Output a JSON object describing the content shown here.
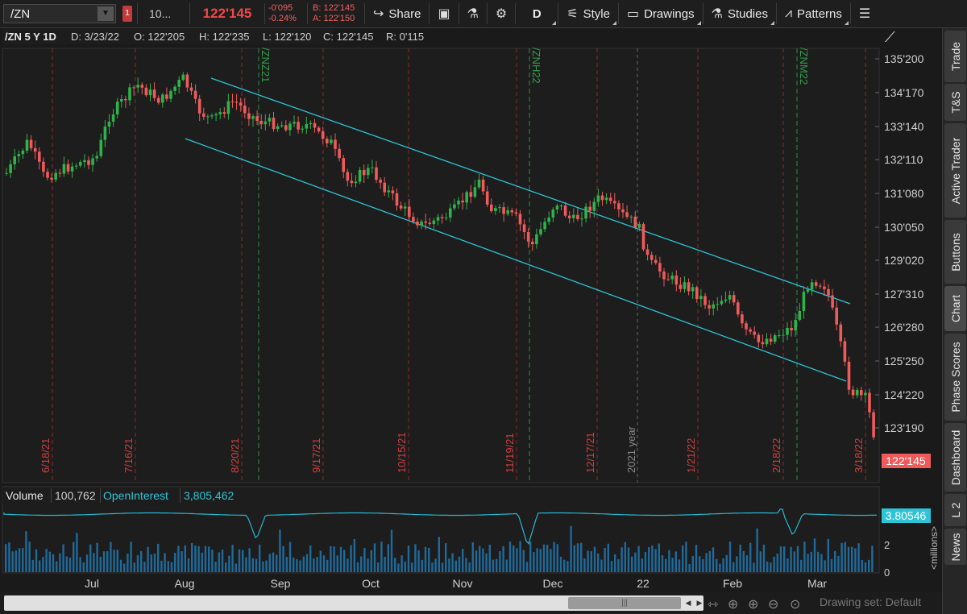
{
  "toolbar": {
    "symbol": "/ZN",
    "link_badge": "1",
    "quantity": "10...",
    "last_price": "122'145",
    "net_change": "-0'095",
    "pct_change": "-0.24%",
    "bid": "B: 122'145",
    "ask": "A: 122'150",
    "share_label": "Share",
    "interval": "D",
    "style_label": "Style",
    "drawings_label": "Drawings",
    "studies_label": "Studies",
    "patterns_label": "Patterns"
  },
  "chart_header": {
    "title": "/ZN 5 Y 1D",
    "date": "D: 3/23/22",
    "open": "O: 122'205",
    "high": "H: 122'235",
    "low": "L: 122'120",
    "close": "C: 122'145",
    "range": "R: 0'115"
  },
  "price_axis": [
    "135'200",
    "134'170",
    "133'140",
    "132'110",
    "131'080",
    "130'050",
    "129'020",
    "127'310",
    "126'280",
    "125'250",
    "124'220",
    "123'190"
  ],
  "current_price_label": "122'145",
  "vertical_markers": {
    "dates": [
      "6/18/21",
      "7/16/21",
      "8/20/21",
      "9/17/21",
      "10/15/21",
      "11/19/21",
      "12/17/21",
      "1/21/22",
      "2/18/22",
      "3/18/22"
    ],
    "rolls": [
      "/ZNZ21",
      "/ZNH22",
      "/ZNM22"
    ],
    "year_label": "2021 year"
  },
  "volume_header": {
    "volume_label": "Volume",
    "volume_value": "100,762",
    "oi_label": "OpenInterest",
    "oi_value": "3,805,462"
  },
  "volume_axis": {
    "oi_marker": "3.80546",
    "ticks": [
      "2",
      "0"
    ],
    "unit": "<millions>"
  },
  "time_axis": [
    "Jul",
    "Aug",
    "Sep",
    "Oct",
    "Nov",
    "Dec",
    "22",
    "Feb",
    "Mar"
  ],
  "side_tabs": [
    "Trade",
    "T&S",
    "Active Trader",
    "Buttons",
    "Chart",
    "Phase Scores",
    "Dashboard",
    "L 2",
    "News"
  ],
  "footer": {
    "drawing_set": "Drawing set: Default"
  },
  "colors": {
    "up": "#2fb24a",
    "down": "#f05a5a",
    "channel": "#2ec4d6",
    "oi_line": "#27b8d0",
    "volume_bar": "#1f6a9a"
  },
  "chart_data": {
    "type": "candlestick",
    "title": "/ZN 5 Y 1D",
    "x_range": [
      "2021-06",
      "2022-03-23"
    ],
    "ylim": [
      "123'190",
      "135'200"
    ],
    "last_close": "122'145",
    "trend_channel": "descending",
    "series": [
      {
        "name": "Volume",
        "last": "100,762"
      },
      {
        "name": "OpenInterest",
        "last": "3,805,462"
      }
    ],
    "x_tick_labels": [
      "Jul",
      "Aug",
      "Sep",
      "Oct",
      "Nov",
      "Dec",
      "22",
      "Feb",
      "Mar"
    ]
  }
}
